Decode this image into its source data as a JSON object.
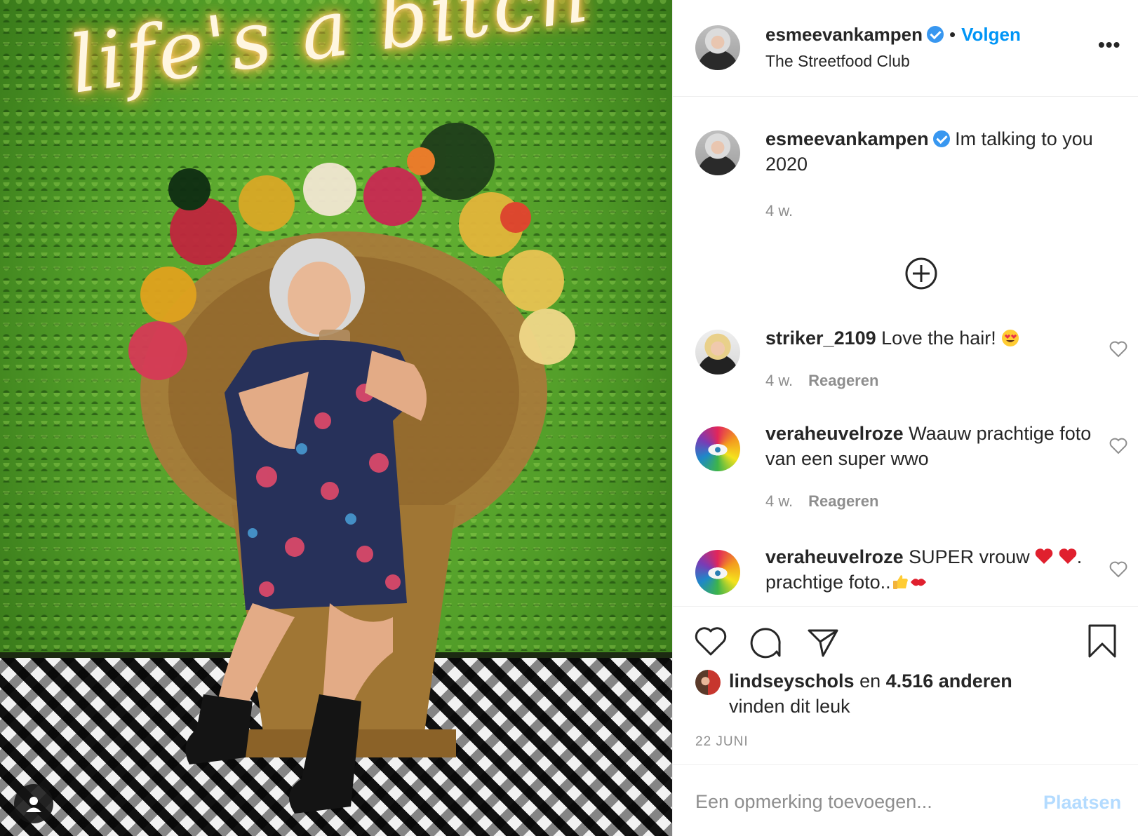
{
  "post": {
    "photo_alt": "Woman on a wicker peacock chair drinking from a jar, neon sign above",
    "neon_text": "life's a bitch"
  },
  "header": {
    "username": "esmeevankampen",
    "dot": "•",
    "follow_label": "Volgen",
    "location": "The Streetfood Club",
    "more": "•••"
  },
  "caption": {
    "username": "esmeevankampen",
    "text": "Im talking to you 2020",
    "age": "4 w."
  },
  "comments": [
    {
      "username": "striker_2109",
      "text": "Love the hair!",
      "emoji": "heart-eyes",
      "age": "4 w.",
      "reply_label": "Reageren"
    },
    {
      "username": "veraheuvelroze",
      "text": "Waauw prachtige foto van een super wwo",
      "age": "4 w.",
      "reply_label": "Reageren"
    },
    {
      "username": "veraheuvelroze",
      "text_a": "SUPER vrouw",
      "text_b": ". prachtige foto..",
      "emojis": [
        "red-heart",
        "red-heart",
        "thumbs-up",
        "kiss"
      ]
    }
  ],
  "likes": {
    "first_user": "lindseyschols",
    "connector": "en",
    "others": "4.516 anderen",
    "suffix": "vinden dit leuk"
  },
  "date": "22 JUNI",
  "add_comment": {
    "placeholder": "Een opmerking toevoegen...",
    "post_label": "Plaatsen"
  },
  "colors": {
    "accent": "#0095f6",
    "verified": "#3897f0",
    "muted": "#8e8e8e",
    "post_disabled": "#b3dbff",
    "text": "#262626"
  }
}
